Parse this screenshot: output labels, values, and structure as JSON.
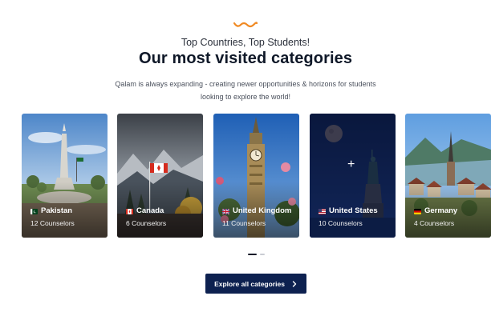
{
  "header": {
    "eyebrow": "Top Countries, Top Students!",
    "title": "Our most visited categories",
    "description": "Qalam is always expanding - creating newer opportunities & horizons for students looking to explore the world!"
  },
  "cards": [
    {
      "country": "Pakistan",
      "counselors": "12 Counselors"
    },
    {
      "country": "Canada",
      "counselors": "6 Counselors"
    },
    {
      "country": "United Kingdom",
      "counselors": "11 Counselors"
    },
    {
      "country": "United States",
      "counselors": "10 Counselors"
    },
    {
      "country": "Germany",
      "counselors": "4 Counselors"
    }
  ],
  "carousel": {
    "active_page": 1,
    "page_count": 2
  },
  "cta": {
    "label": "Explore all categories"
  },
  "colors": {
    "accent": "#f08a24",
    "brand_dark": "#0d2150"
  }
}
